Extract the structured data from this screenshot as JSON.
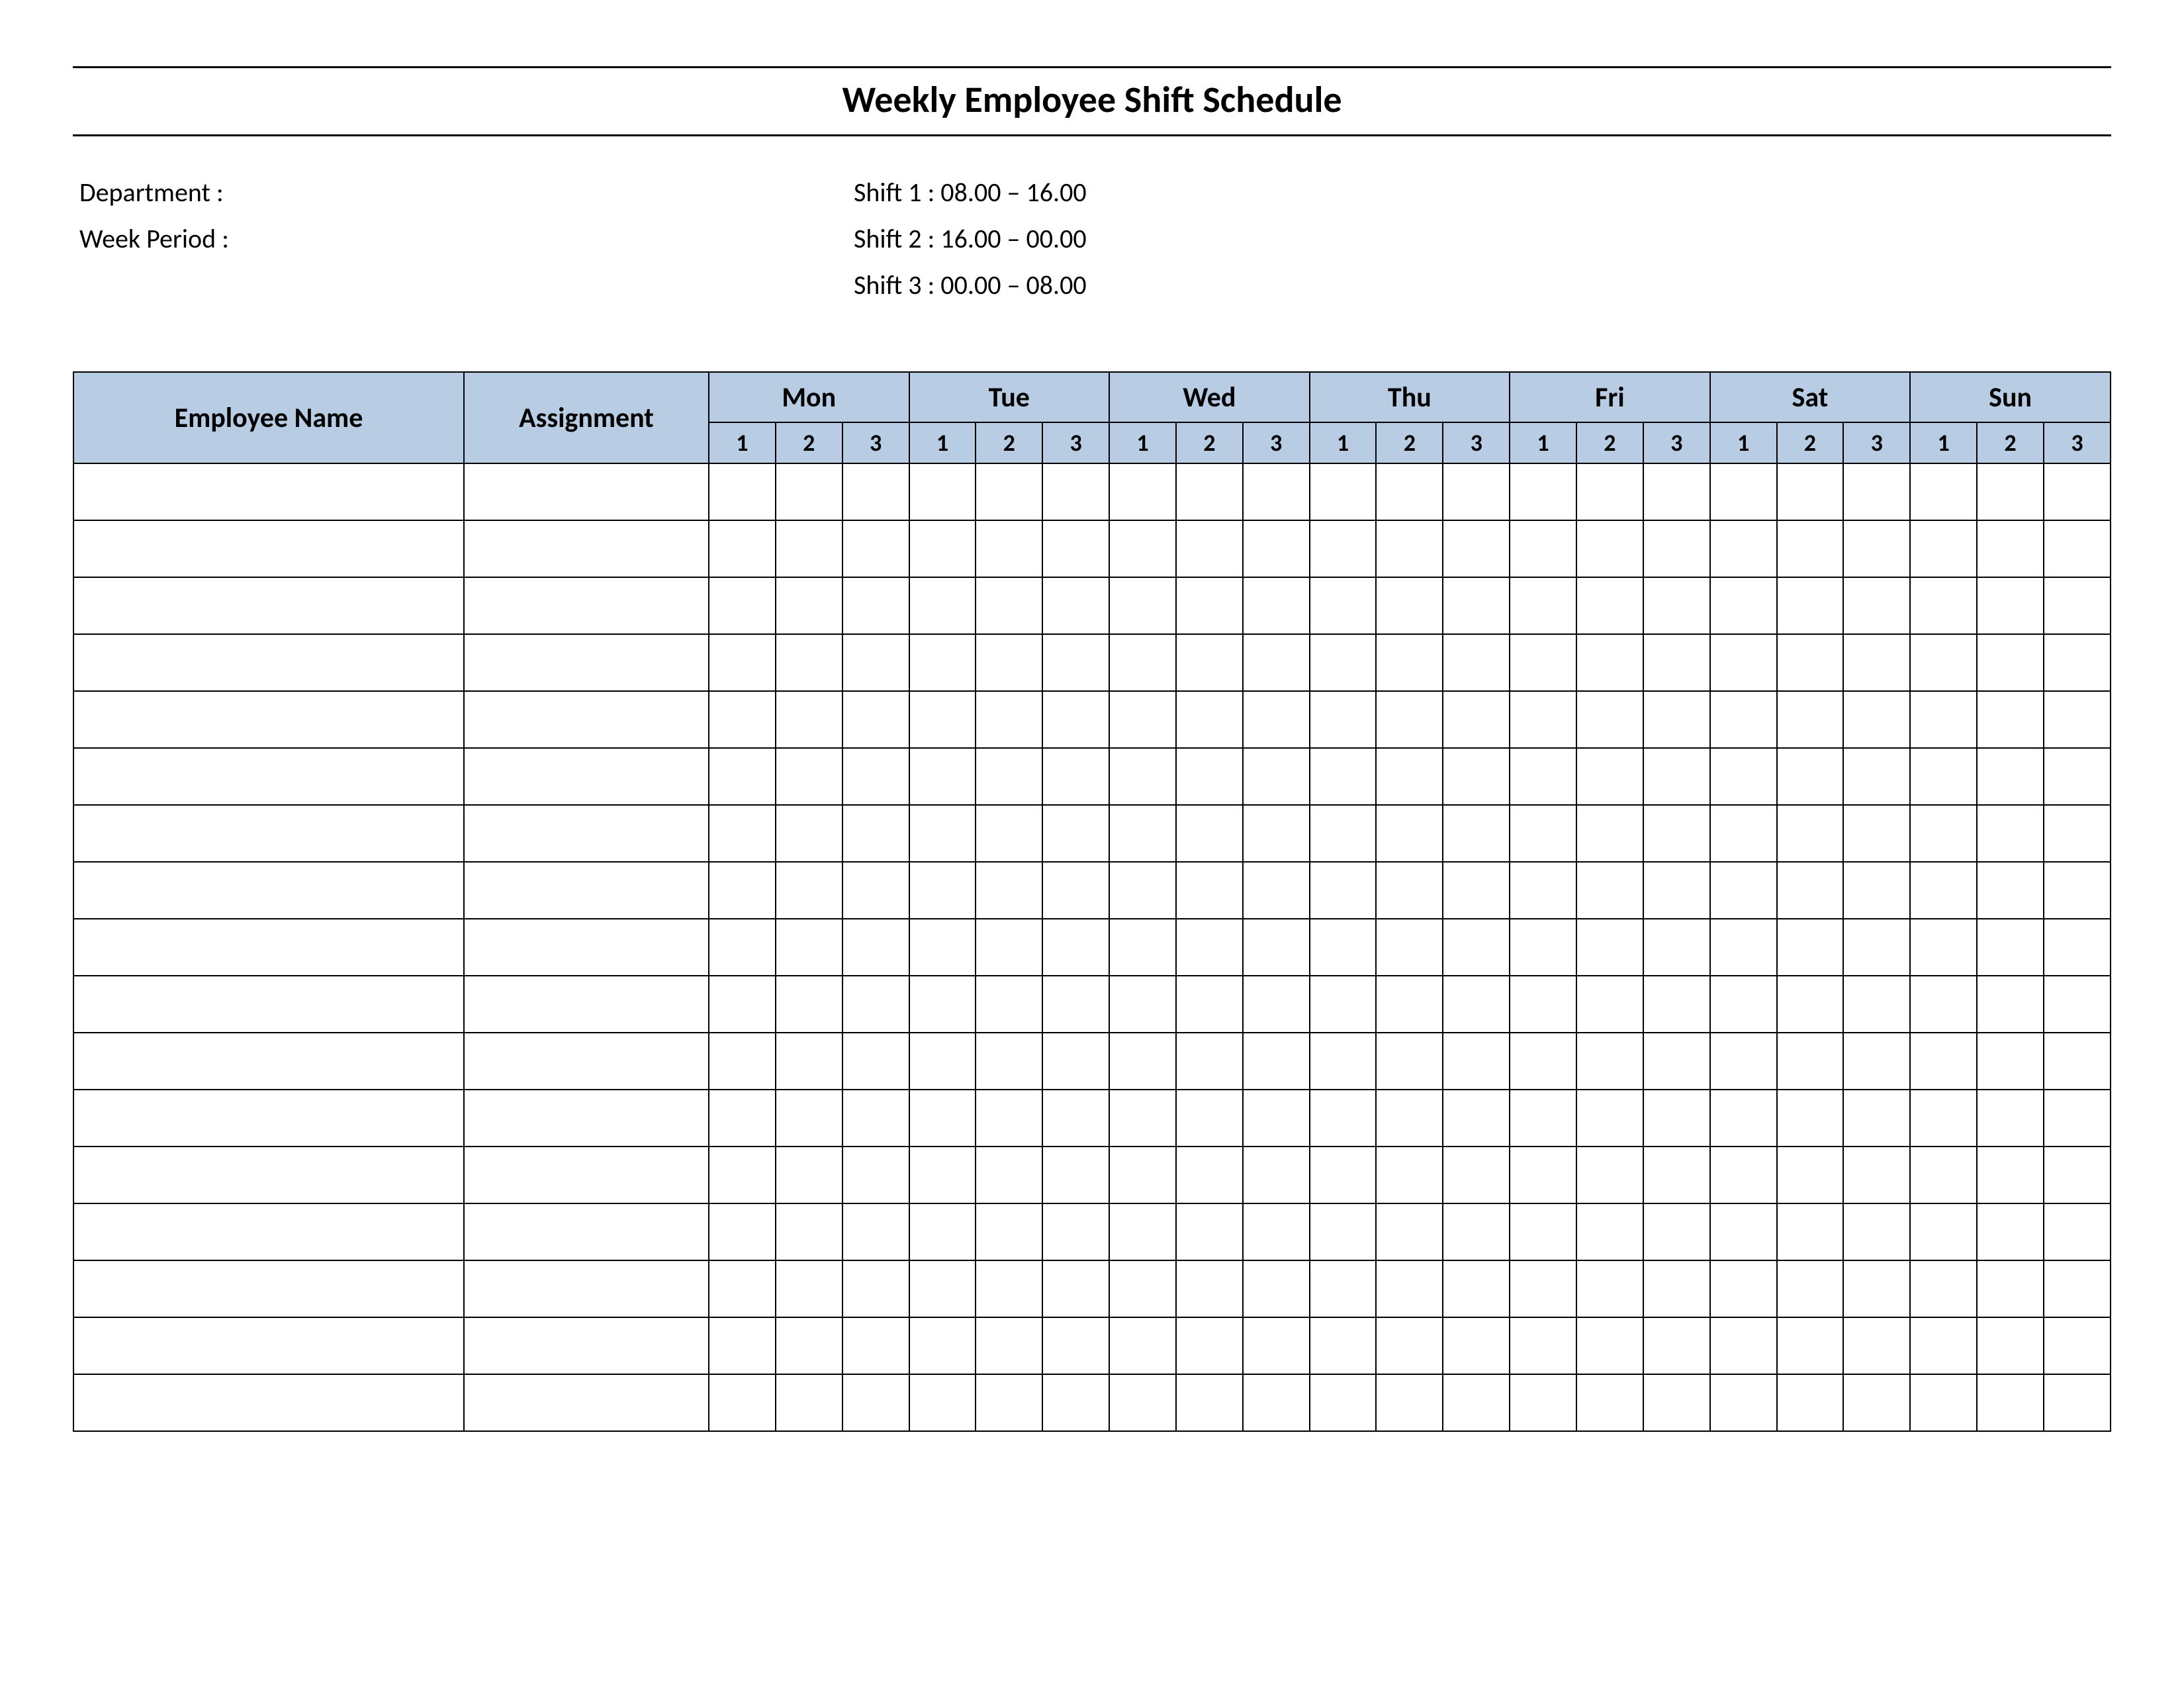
{
  "title": "Weekly Employee Shift Schedule",
  "info": {
    "department_label": "Department    :",
    "week_period_label": "Week  Period :",
    "shift1": "Shift 1  : 08.00  – 16.00",
    "shift2": "Shift 2  : 16.00  – 00.00",
    "shift3": "Shift 3  : 00.00  – 08.00"
  },
  "headers": {
    "employee_name": "Employee Name",
    "assignment": "Assignment",
    "days": [
      "Mon",
      "Tue",
      "Wed",
      "Thu",
      "Fri",
      "Sat",
      "Sun"
    ],
    "shifts": [
      "1",
      "2",
      "3"
    ]
  },
  "row_count": 17
}
